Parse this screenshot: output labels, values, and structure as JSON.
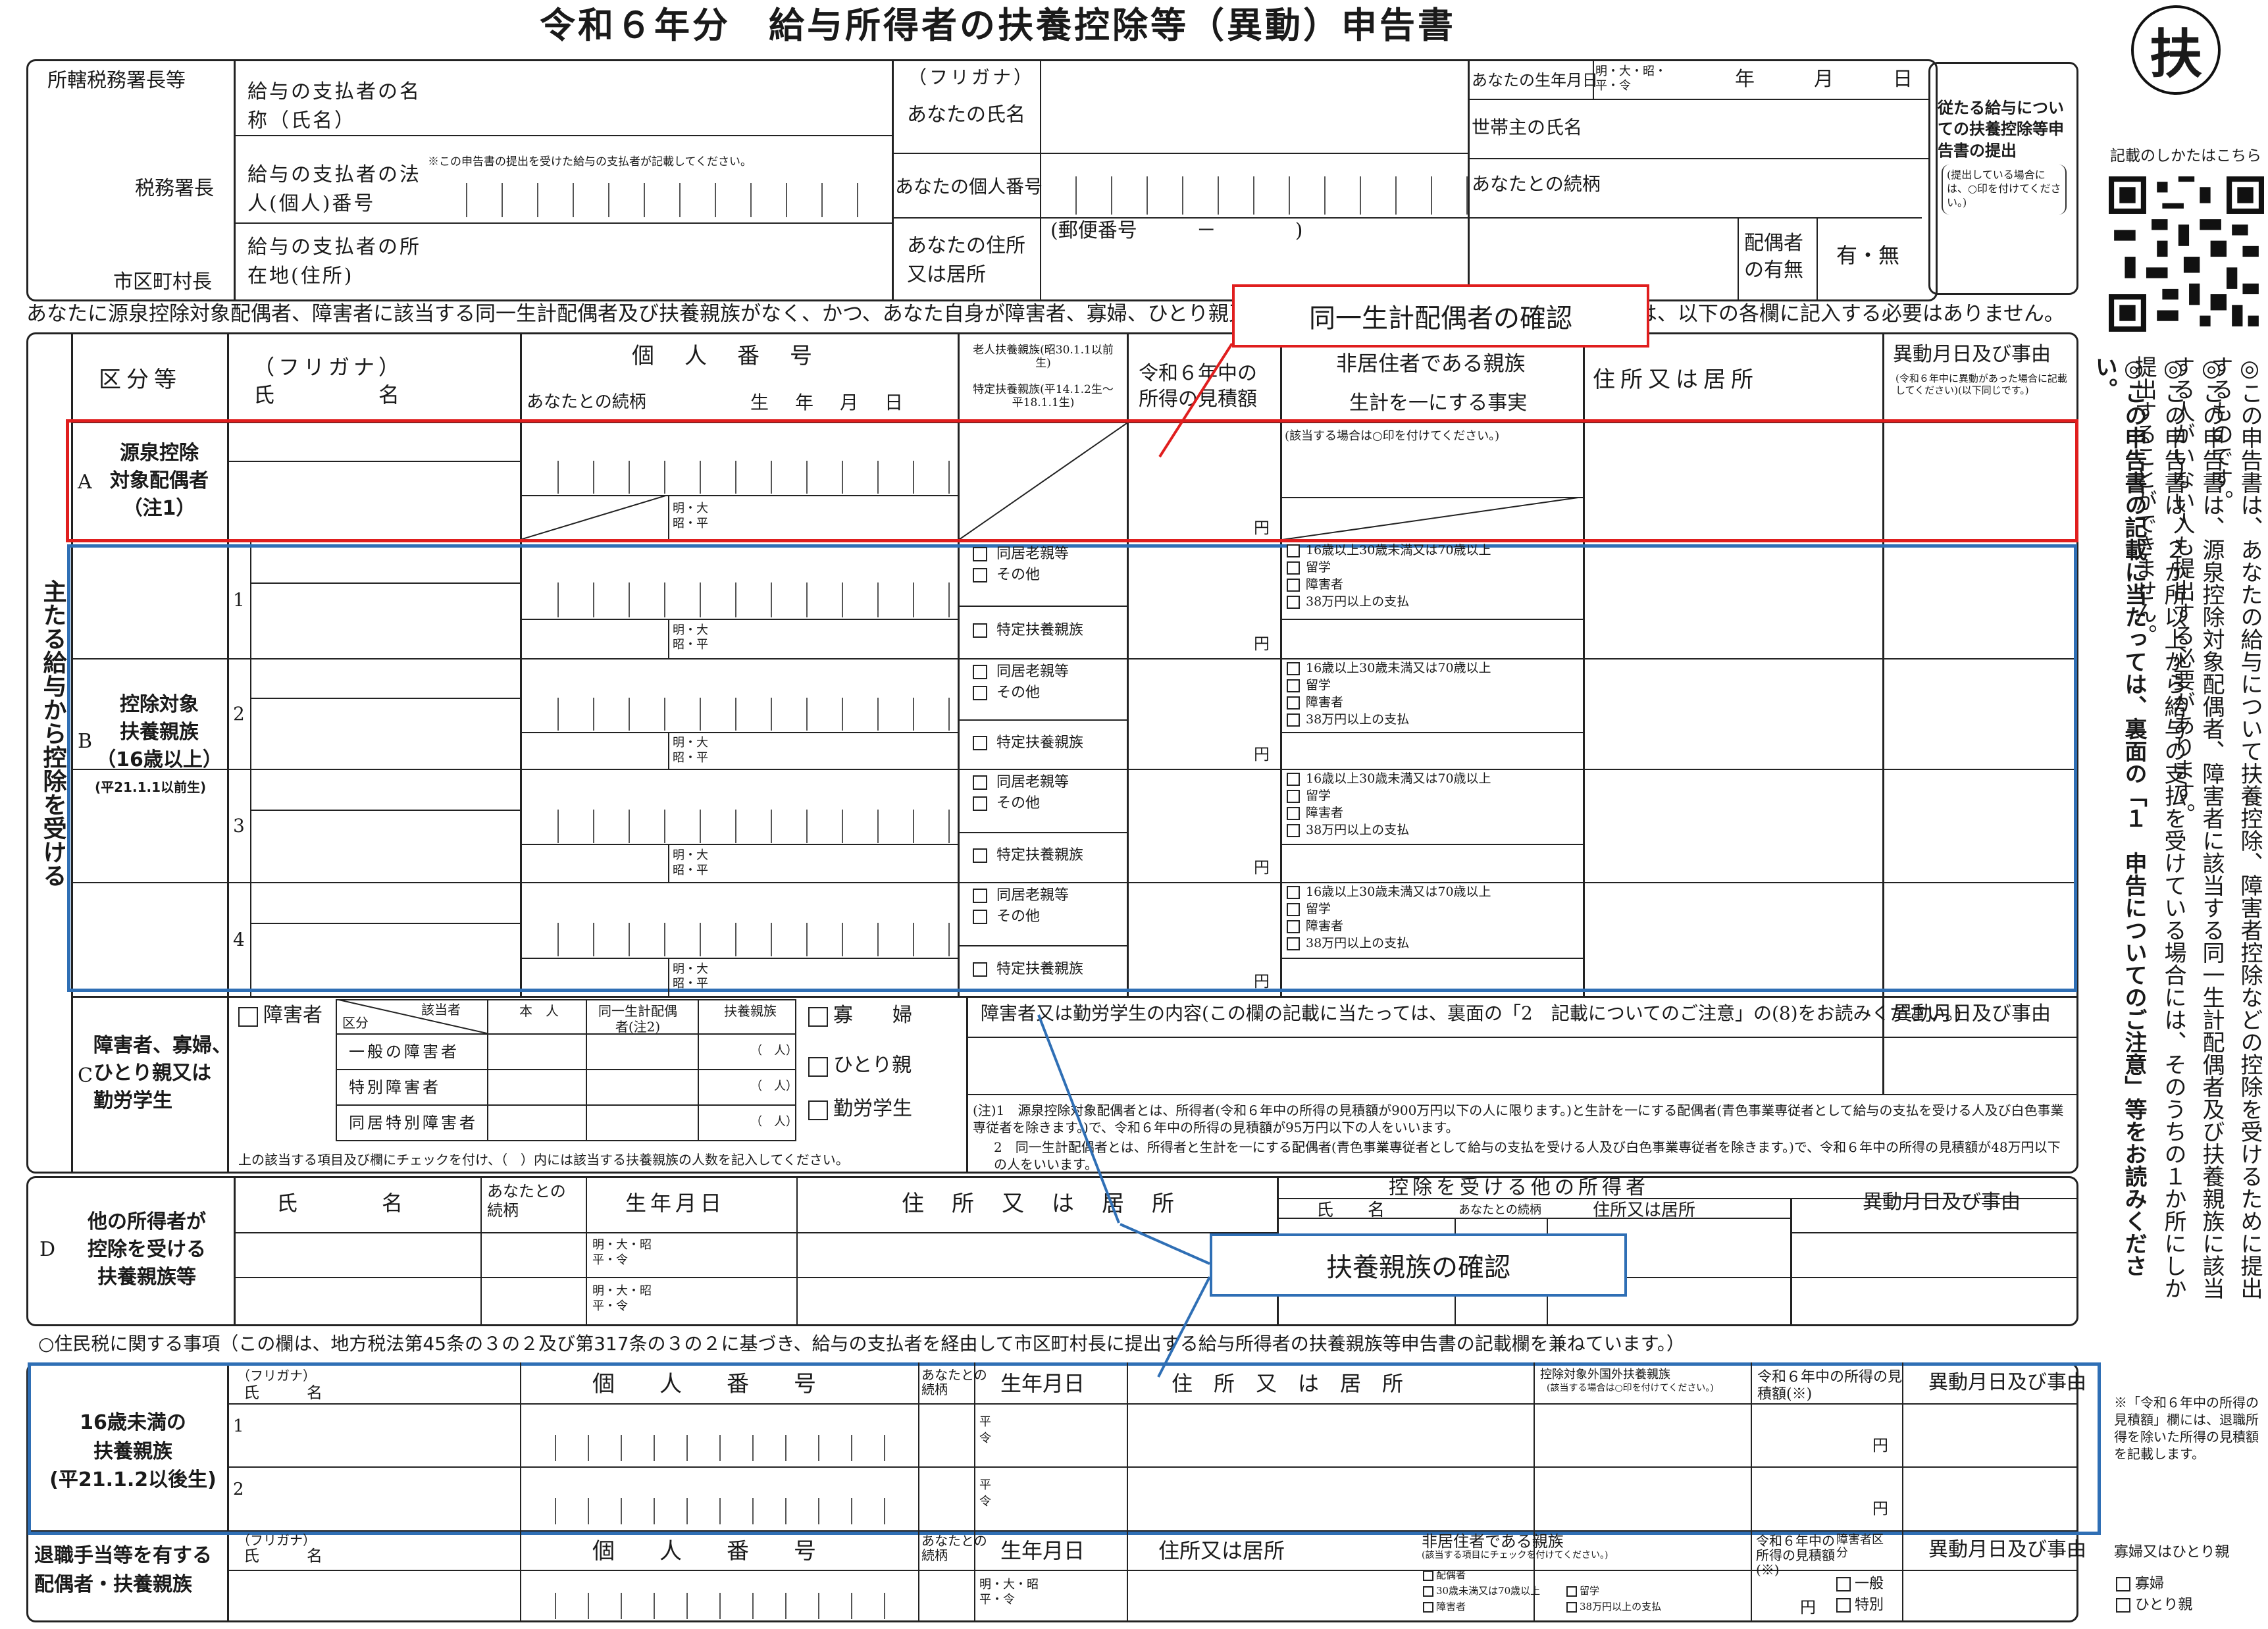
{
  "title": "令和６年分　給与所得者の扶養控除等（異動）申告書",
  "stamp": "扶",
  "qr_caption": "記載のしかたはこちら",
  "header": {
    "office_label": "所轄税務署長等",
    "tax_office_suffix": "税務署長",
    "city_suffix": "市区町村長",
    "payer_name": "給与の支払者の名称（氏名）",
    "payer_number": "給与の支払者の法人(個人)番号",
    "payer_note": "※この申告書の提出を受けた給与の支払者が記載してください。",
    "payer_address": "給与の支払者の所在地(住所)",
    "furigana": "（フリガナ）",
    "your_name": "あなたの氏名",
    "your_number": "あなたの個人番号",
    "your_address": "あなたの住所又は居所",
    "postal": "(郵便番号　　　－　　　　)",
    "birth_label": "あなたの生年月日",
    "era": "明・大・昭・平・令",
    "ymd": "年　　　月　　　日",
    "householder": "世帯主の氏名",
    "relation": "あなたとの続柄",
    "spouse_presence": "配偶者の有無",
    "yes_no": "有・無",
    "secondary_title": "従たる給与についての扶養控除等申告書の提出",
    "secondary_note": "(提出している場合には、○印を付けてください。)"
  },
  "notice_line": "あなたに源泉控除対象配偶者、障害者に該当する同一生計配偶者及び扶養親族がなく、かつ、あなた自身が障害者、寡婦、ひとり親又は勤労学生のいずれにも該当しない場合には、以下の各欄に記入する必要はありません。",
  "callouts": {
    "spouse": "同一生計配偶者の確認",
    "dependents": "扶養親族の確認"
  },
  "main": {
    "side_label": "主たる給与から控除を受ける",
    "col_category": "区分等",
    "col_name": "（フリガナ）\n氏　　　　名",
    "col_number": "個　人　番　号",
    "col_relation": "あなたとの続柄",
    "col_birth": "生　年　月　日",
    "col_elderly": "老人扶養親族(昭30.1.1以前生)",
    "col_specific": "特定扶養親族(平14.1.2生〜平18.1.1生)",
    "col_income": "令和６年中の所得の見積額",
    "col_nonres": "非居住者である親族",
    "col_livelihood": "生計を一にする事実",
    "col_address": "住所又は居所",
    "col_change": "異動月日及び事由",
    "change_note": "(令和６年中に異動があった場合に記載してください)(以下同じです。)",
    "nonres_note": "(該当する場合は○印を付けてください。)",
    "era_short": "明・大\n昭・平",
    "yen": "円",
    "spouse_label": "源泉控除\n対象配偶者\n（注1）",
    "spouse_letter": "A",
    "dep_letter": "B",
    "dep_label": "控除対象\n扶養親族\n（16歳以上）",
    "dep_born": "(平21.1.1以前生)",
    "rows": [
      "1",
      "2",
      "3",
      "4"
    ],
    "elderly_opts": [
      "同居老親等",
      "その他"
    ],
    "specific_opt": "特定扶養親族",
    "nonres_opts": [
      "16歳以上30歳未満又は70歳以上",
      "留学",
      "障害者",
      "38万円以上の支払"
    ]
  },
  "sectionC": {
    "letter": "C",
    "label": "障害者、寡婦、\nひとり親又は\n勤労学生",
    "disabled": "障害者",
    "kubun": "区分",
    "gaitousha": "該当者",
    "cols": [
      "本　人",
      "同一生計配偶者(注2)",
      "扶養親族"
    ],
    "rows": [
      "一般の障害者",
      "特別障害者",
      "同居特別障害者"
    ],
    "persons": "（　人）",
    "widow": "寡　　婦",
    "single_parent": "ひとり親",
    "student": "勤労学生",
    "footnote": "上の該当する項目及び欄にチェックを付け、（　）内には該当する扶養親族の人数を記入してください。",
    "content_head": "障害者又は勤労学生の内容(この欄の記載に当たっては、裏面の「2　記載についてのご注意」の(8)をお読みください。)",
    "change_head": "異動月日及び事由",
    "note1": "(注)1　源泉控除対象配偶者とは、所得者(令和６年中の所得の見積額が900万円以下の人に限ります。)と生計を一にする配偶者(青色事業専従者として給与の支払を受ける人及び白色事業専従者を除きます。)で、令和６年中の所得の見積額が95万円以下の人をいいます。",
    "note2": "2　同一生計配偶者とは、所得者と生計を一にする配偶者(青色事業専従者として給与の支払を受ける人及び白色事業専従者を除きます。)で、令和６年中の所得の見積額が48万円以下の人をいいます。"
  },
  "sectionD": {
    "letter": "D",
    "label": "他の所得者が\n控除を受ける\n扶養親族等",
    "name": "氏　　　　名",
    "relation": "あなたとの続柄",
    "birth": "生年月日",
    "address": "住　所　又　は　居　所",
    "other_head": "控除を受ける他の所得者",
    "other_name": "氏　　名",
    "other_rel": "あなたとの続柄",
    "other_addr": "住所又は居所",
    "change": "異動月日及び事由",
    "era": "明・大・昭\n平・令"
  },
  "resident_tax": "○住民税に関する事項（この欄は、地方税法第45条の３の２及び第317条の３の２に基づき、給与の支払者を経由して市区町村長に提出する給与所得者の扶養親族等申告書の記載欄を兼ねています。）",
  "under16": {
    "label": "16歳未満の\n扶養親族\n(平21.1.2以後生)",
    "furigana": "（フリガナ）",
    "name": "氏　　　名",
    "number": "個　　人　　番　　号",
    "relation": "あなたとの続柄",
    "birth": "生年月日",
    "address": "住　所　又　は　居　所",
    "foreign": "控除対象外国外扶養親族",
    "foreign_note": "(該当する場合は○印を付けてください。)",
    "income": "令和６年中の所得の見積額(※)",
    "change": "異動月日及び事由",
    "era": "平\n令",
    "yen": "円",
    "rows": [
      "1",
      "2"
    ],
    "side_note": "※「令和６年中の所得の見積額」欄には、退職所得を除いた所得の見積額を記載します。"
  },
  "retire": {
    "label": "退職手当等を有する\n配偶者・扶養親族",
    "furigana": "（フリガナ）",
    "name": "氏　　　名",
    "number": "個　　人　　番　　号",
    "relation": "あなたとの続柄",
    "birth": "生年月日",
    "address": "住所又は居所",
    "nonres": "非居住者である親族",
    "nonres_note": "(該当する項目にチェックを付けてください。)",
    "income": "令和６年中の所得の見積額(※)",
    "kubun": "障害者区分",
    "change": "異動月日及び事由",
    "era": "明・大・昭\n平・令",
    "nonres_opts": [
      "配偶者",
      "30歳未満又は70歳以上",
      "留学",
      "障害者",
      "38万円以上の支払"
    ],
    "kubun_opts": [
      "一般",
      "特別"
    ],
    "yen": "円",
    "widow_head": "寡婦又はひとり親",
    "widow_opts": [
      "寡婦",
      "ひとり親"
    ]
  },
  "right_column": [
    "◎この申告書は、あなたの給与について扶養控除、障害者控除などの控除を受けるために提出するものです。",
    "◎この申告書は、源泉控除対象配偶者、障害者に該当する同一生計配偶者及び扶養親族に該当する人がいない人も提出する必要があります。",
    "◎この申告書は、２か所以上から給与の支払を受けている場合には、そのうちの１か所にしか提出することができません。",
    "◎この申告書の記載に当たっては、裏面の「１　申告についてのご注意」等をお読みください。"
  ]
}
